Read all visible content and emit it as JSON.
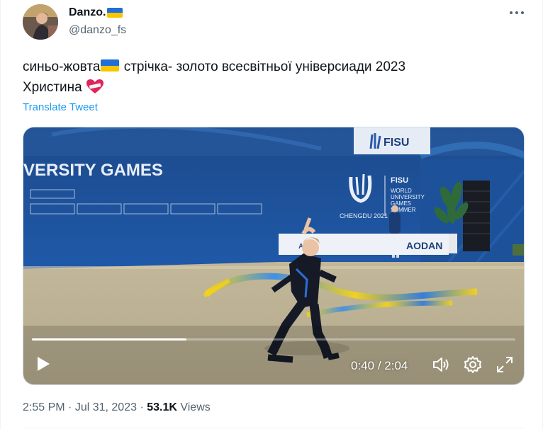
{
  "author": {
    "name": "Danzo.",
    "handle": "@danzo_fs"
  },
  "tweet": {
    "line1_part1": "синьо-жовта",
    "line1_part2": " стрічка- золото всесвітньої універсиади 2023",
    "line2": "Христина ",
    "translate_label": "Translate Tweet"
  },
  "video": {
    "current_time": "0:40",
    "separator": " / ",
    "duration": "2:04",
    "progress_fraction": 0.32,
    "signage": {
      "banner_text": "VERSITY GAMES",
      "fisu_top": "FISU",
      "city": "CHENGDU 2021",
      "fisu_logo_text": "FISU",
      "games_lines": [
        "WORLD",
        "UNIVERSITY",
        "GAMES",
        "SUMMER"
      ],
      "sponsor_1": "AIR",
      "sponsor_2": "AODAN"
    }
  },
  "meta": {
    "time": "2:55 PM",
    "dot": " · ",
    "date": "Jul 31, 2023",
    "views_count": "53.1K",
    "views_label": " Views"
  },
  "colors": {
    "flag_blue": "#1f6fd6",
    "flag_yellow": "#f7c600",
    "link": "#1d9bf0",
    "secondary_text": "#536471"
  }
}
